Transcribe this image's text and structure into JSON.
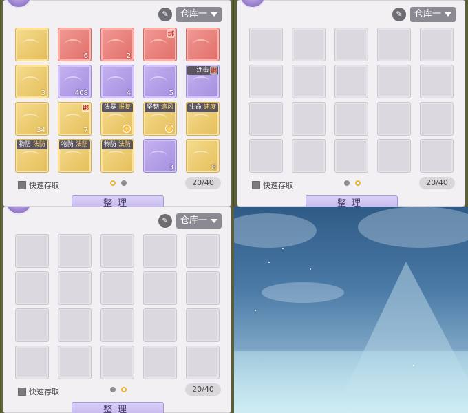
{
  "storage": {
    "dropdown_label": "仓库一",
    "quick_access_label": "快速存取",
    "capacity": "20/40",
    "sort_label": "整理",
    "brush_icon": "brush-icon"
  },
  "panels": [
    {
      "id": "top-left",
      "active_page": 1,
      "slots": [
        {
          "color": "gold"
        },
        {
          "color": "red",
          "count": "6"
        },
        {
          "color": "red",
          "count": "2"
        },
        {
          "color": "red",
          "bind": "绑"
        },
        {
          "color": "red"
        },
        {
          "color": "gold",
          "count": "3"
        },
        {
          "color": "purple",
          "count": "408"
        },
        {
          "color": "purple",
          "count": "4"
        },
        {
          "color": "purple",
          "count": "5"
        },
        {
          "color": "purple",
          "tags": [
            "连击"
          ],
          "bind": "绑"
        },
        {
          "color": "gold",
          "count": "34"
        },
        {
          "color": "gold",
          "count": "7",
          "bind": "绑"
        },
        {
          "color": "gold",
          "tags": [
            "法暴",
            "报复"
          ],
          "coin": true
        },
        {
          "color": "gold",
          "tags": [
            "坚韧",
            "追风"
          ],
          "coin": true
        },
        {
          "color": "gold",
          "tags": [
            "生命",
            "速度"
          ]
        },
        {
          "color": "gold",
          "tags": [
            "物防",
            "法防"
          ]
        },
        {
          "color": "gold",
          "tags": [
            "物防",
            "法防"
          ]
        },
        {
          "color": "gold",
          "tags": [
            "物防",
            "法防"
          ]
        },
        {
          "color": "purple",
          "count": "3"
        },
        {
          "color": "gold",
          "count": "8"
        }
      ]
    },
    {
      "id": "top-right",
      "active_page": 2,
      "slots": []
    },
    {
      "id": "bottom-left",
      "active_page": 2,
      "slots": []
    }
  ]
}
